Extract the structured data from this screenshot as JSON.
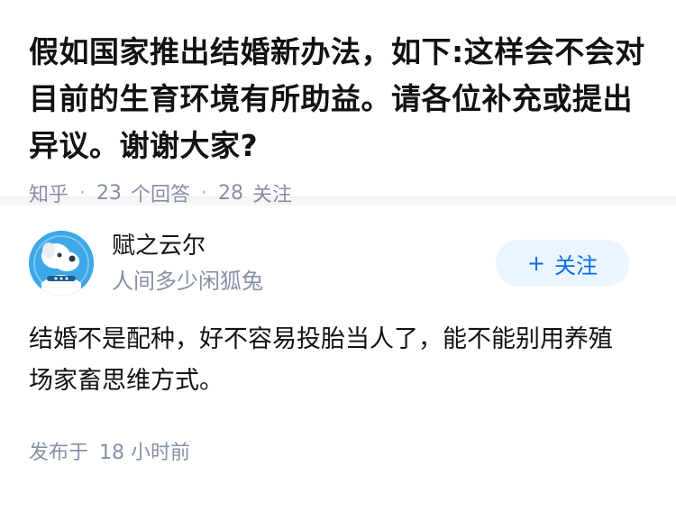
{
  "question": {
    "title": "假如国家推出结婚新办法，如下:这样会不会对目前的生育环境有所助益。请各位补充或提出异议。谢谢大家?",
    "source": "知乎",
    "answers_count": "23",
    "answers_label": "个回答",
    "followers_count": "28",
    "followers_label": "关注"
  },
  "answer": {
    "author": {
      "name": "赋之云尔",
      "bio": "人间多少闲狐兔",
      "avatar_icon": "cartoon-dog-avatar"
    },
    "follow_button": {
      "plus": "+",
      "label": "关注"
    },
    "content": "结婚不是配种，好不容易投胎当人了，能不能别用养殖场家畜思维方式。",
    "published_label": "发布于",
    "published_time": "18 小时前"
  },
  "colors": {
    "title": "#121212",
    "meta": "#8590a6",
    "accent": "#056de8",
    "follow_bg": "#ebf5ff",
    "avatar_bg": "#3ea7e8"
  }
}
